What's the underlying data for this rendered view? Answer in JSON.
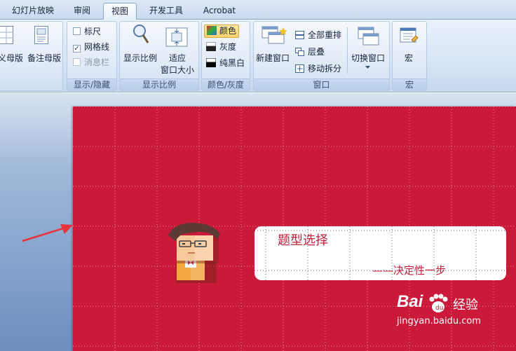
{
  "tabs": [
    {
      "label": "幻灯片放映",
      "active": false
    },
    {
      "label": "审阅",
      "active": false
    },
    {
      "label": "视图",
      "active": true
    },
    {
      "label": "开发工具",
      "active": false
    },
    {
      "label": "Acrobat",
      "active": false
    }
  ],
  "ribbon": {
    "masters": {
      "item1": "义母版",
      "item2": "备注母版"
    },
    "show_hide": {
      "label": "显示/隐藏",
      "ruler": "标尺",
      "ruler_checked": false,
      "grid": "网格线",
      "grid_checked": true,
      "message_bar": "消息栏",
      "message_bar_checked": false
    },
    "zoom": {
      "label": "显示比例",
      "zoom_button": "显示比例",
      "fit_line1": "适应",
      "fit_line2": "窗口大小"
    },
    "color": {
      "label": "颜色/灰度",
      "color": "颜色",
      "grayscale": "灰度",
      "bw": "纯黑白"
    },
    "window": {
      "label": "窗口",
      "new_window": "新建窗口",
      "arrange_all": "全部重排",
      "cascade": "层叠",
      "move_split": "移动拆分",
      "switch": "切换窗口"
    },
    "macro": {
      "label": "宏",
      "macro_button": "宏"
    }
  },
  "slide": {
    "title": "题型选择",
    "subtitle": "——决定性一步",
    "background_color": "#cb1a39"
  },
  "watermark": {
    "brand": "Bai",
    "brand_cn": "经验",
    "url": "jingyan.baidu.com"
  },
  "colors": {
    "accent": "#cb1a39",
    "arrow": "#e8343a",
    "ribbon": "#d3e2f4"
  }
}
